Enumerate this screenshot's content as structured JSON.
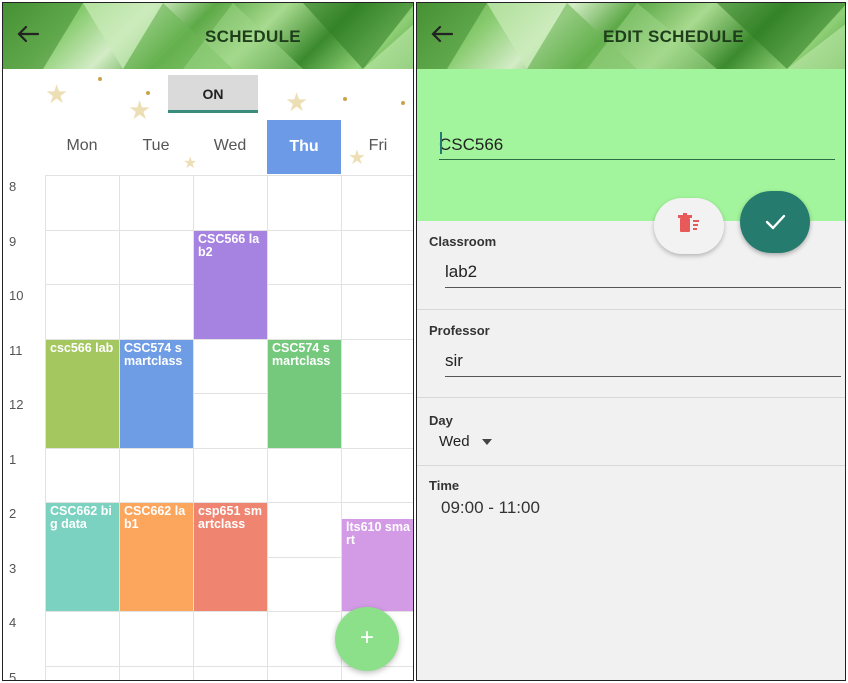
{
  "schedule": {
    "title": "SCHEDULE",
    "toggle_label": "ON",
    "days": [
      {
        "label": "Mon",
        "active": false
      },
      {
        "label": "Tue",
        "active": false
      },
      {
        "label": "Wed",
        "active": false
      },
      {
        "label": "Thu",
        "active": true
      },
      {
        "label": "Fri",
        "active": false
      }
    ],
    "hours": [
      "8",
      "9",
      "10",
      "11",
      "12",
      "1",
      "2",
      "3",
      "4",
      "5"
    ],
    "events": [
      {
        "text": "CSC566 lab2",
        "day": 2,
        "start": 1,
        "end": 3,
        "color": "#a683e0"
      },
      {
        "text": "csc566 lab",
        "day": 0,
        "start": 3,
        "end": 5,
        "color": "#a4c760"
      },
      {
        "text": "CSC574 smartclass",
        "day": 1,
        "start": 3,
        "end": 5,
        "color": "#6f9de5"
      },
      {
        "text": "CSC574 smartclass",
        "day": 3,
        "start": 3,
        "end": 5,
        "color": "#74c97d"
      },
      {
        "text": "CSC662 big data",
        "day": 0,
        "start": 6,
        "end": 8,
        "color": "#7bd2c0"
      },
      {
        "text": "CSC662 lab1",
        "day": 1,
        "start": 6,
        "end": 8,
        "color": "#fca65d"
      },
      {
        "text": "csp651 smartclass",
        "day": 2,
        "start": 6,
        "end": 8,
        "color": "#ef8571"
      },
      {
        "text": "lts610 smart",
        "day": 4,
        "start": 6.3,
        "end": 8,
        "color": "#d39be6"
      }
    ],
    "fab_add": "+"
  },
  "edit": {
    "title": "EDIT SCHEDULE",
    "course": "CSC566",
    "classroom_label": "Classroom",
    "classroom": "lab2",
    "professor_label": "Professor",
    "professor": "sir",
    "day_label": "Day",
    "day_value": "Wed",
    "time_label": "Time",
    "time_value": "09:00 - 11:00"
  },
  "colors": {
    "accent": "#247b6e",
    "header_green": "#5da947",
    "course_bg": "#a2f59c"
  }
}
